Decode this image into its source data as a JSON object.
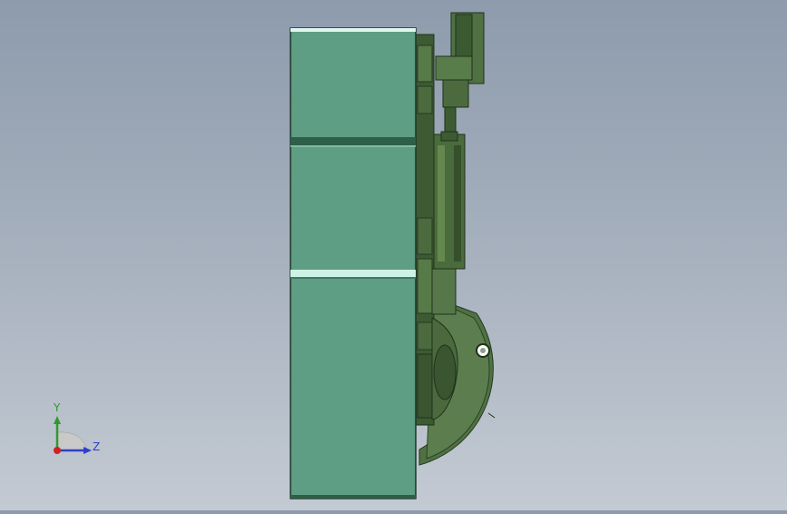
{
  "viewport": {
    "colors": {
      "background_top": "#8d9bac",
      "background_bottom": "#c3cad3",
      "part_face": "#5e9e84",
      "part_dark": "#2f4d2a",
      "part_mid": "#4e6e40",
      "highlight": "#dff7ee"
    }
  },
  "triad": {
    "y_label": "Y",
    "z_label": "Z",
    "colors": {
      "y_axis": "#2e9a2e",
      "z_axis": "#2e3fc7",
      "x_axis": "#d02020"
    }
  }
}
